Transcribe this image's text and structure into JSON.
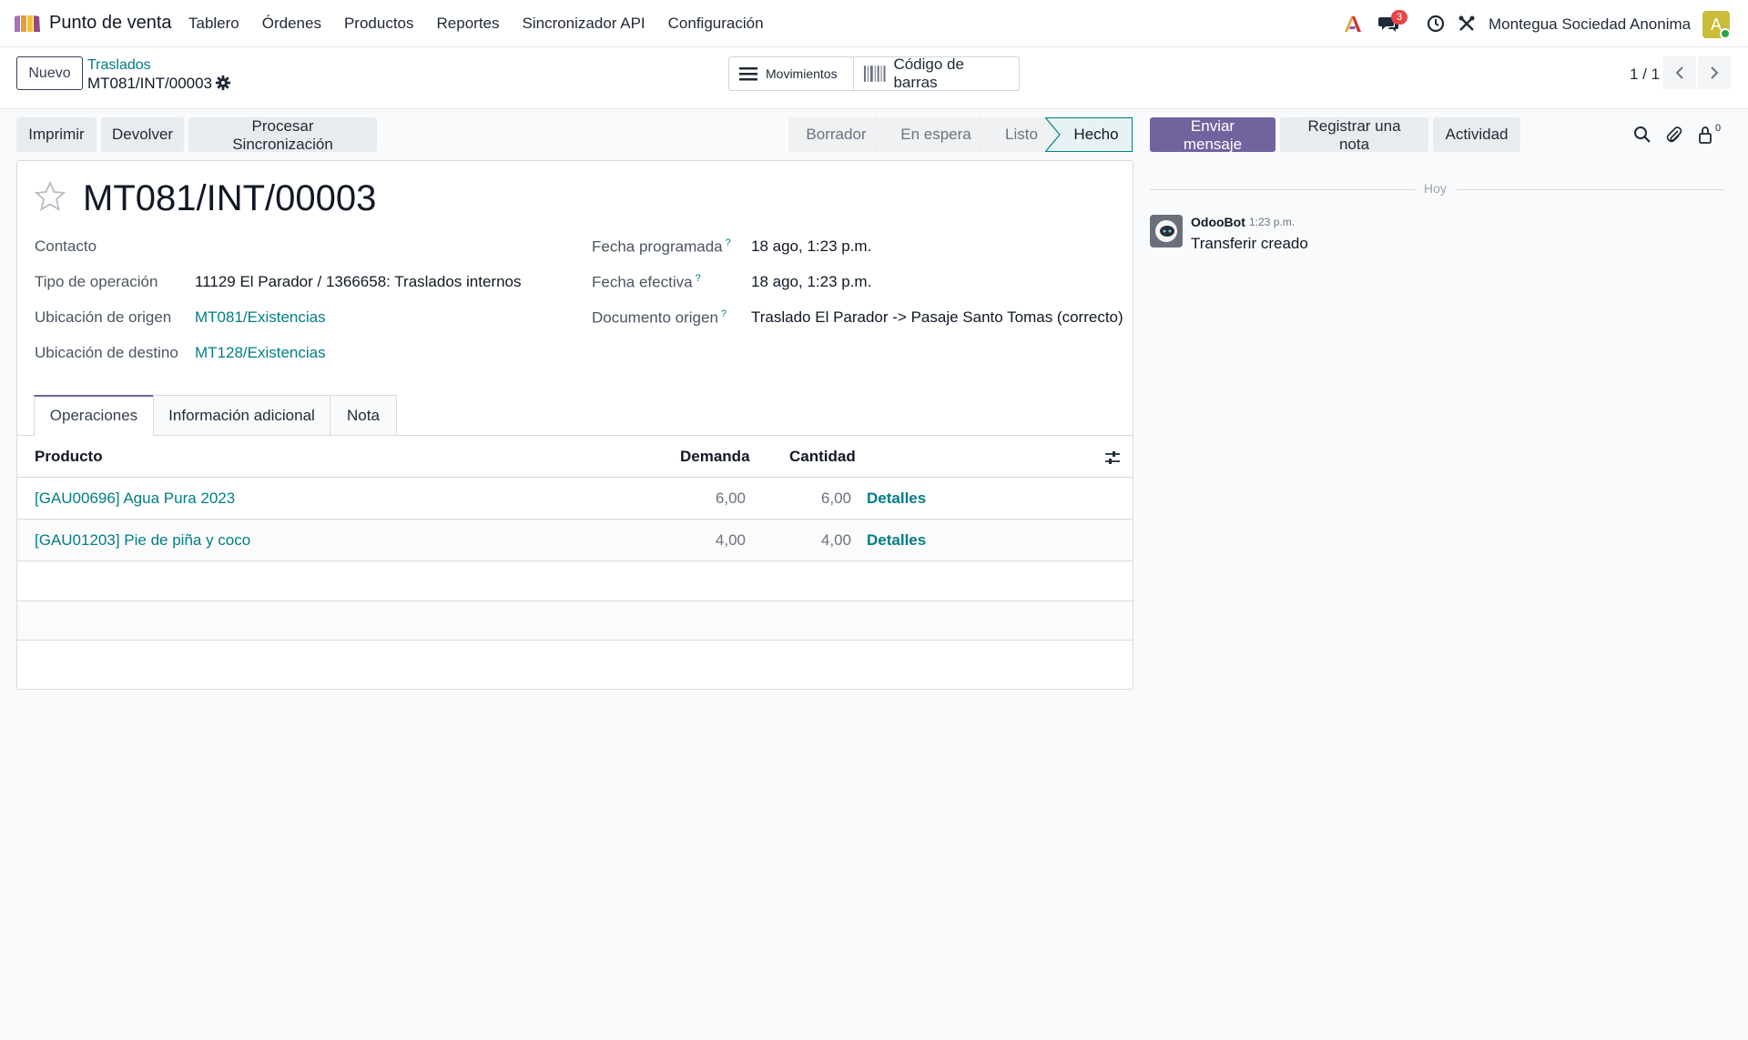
{
  "navbar": {
    "app_name": "Punto de venta",
    "menu": [
      "Tablero",
      "Órdenes",
      "Productos",
      "Reportes",
      "Sincronizador API",
      "Configuración"
    ],
    "chat_badge": "3",
    "company": "Montegua Sociedad Anonima",
    "avatar_letter": "A"
  },
  "control": {
    "new_button": "Nuevo",
    "breadcrumb_parent": "Traslados",
    "breadcrumb_current": "MT081/INT/00003",
    "smart_moves": "Movimientos",
    "smart_barcode": "Código de barras",
    "pager": "1 / 1"
  },
  "actions": {
    "print": "Imprimir",
    "return": "Devolver",
    "sync": "Procesar Sincronización"
  },
  "statusbar": [
    "Borrador",
    "En espera",
    "Listo",
    "Hecho"
  ],
  "form": {
    "title": "MT081/INT/00003",
    "contact_label": "Contacto",
    "operation_type_label": "Tipo de operación",
    "operation_type_value": "11129 El Parador / 1366658: Traslados internos",
    "source_loc_label": "Ubicación de origen",
    "source_loc_value": "MT081/Existencias",
    "dest_loc_label": "Ubicación de destino",
    "dest_loc_value": "MT128/Existencias",
    "scheduled_label": "Fecha programada",
    "scheduled_value": "18 ago, 1:23 p.m.",
    "effective_label": "Fecha efectiva",
    "effective_value": "18 ago, 1:23 p.m.",
    "origin_label": "Documento origen",
    "origin_value": "Traslado El Parador -> Pasaje Santo Tomas (correcto)",
    "help_mark": "?"
  },
  "tabs": [
    "Operaciones",
    "Información adicional",
    "Nota"
  ],
  "table": {
    "columns": [
      "Producto",
      "Demanda",
      "Cantidad"
    ],
    "rows": [
      {
        "product": "[GAU00696] Agua Pura 2023",
        "demand": "6,00",
        "qty": "6,00",
        "link": "Detalles"
      },
      {
        "product": "[GAU01203] Pie de piña y coco",
        "demand": "4,00",
        "qty": "4,00",
        "link": "Detalles"
      }
    ]
  },
  "chatter": {
    "send_message": "Enviar mensaje",
    "log_note": "Registrar una nota",
    "activity": "Actividad",
    "followers_count": "0",
    "date_separator": "Hoy",
    "message_author": "OdooBot",
    "message_time": "1:23 p.m.",
    "message_body": "Transferir creado"
  },
  "colors": {
    "accent": "#71639e",
    "link": "#017e84",
    "badge": "#e64545"
  }
}
